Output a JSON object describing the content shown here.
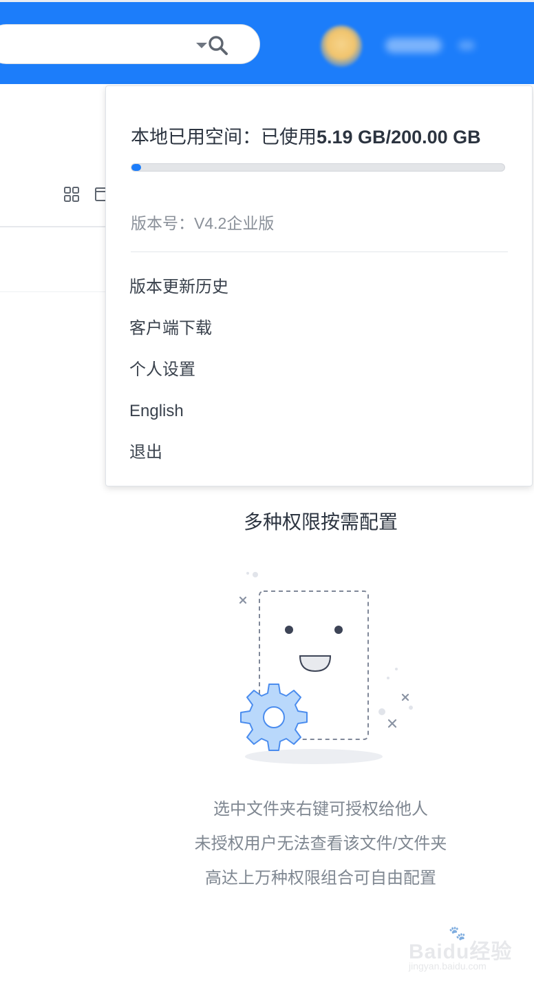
{
  "header": {
    "search": {
      "value": "",
      "placeholder": ""
    },
    "user": {
      "avatar": "blurred-avatar",
      "name": ""
    }
  },
  "colors": {
    "brand_blue": "#1c7dfa",
    "text_dark": "#2c3440",
    "text_muted": "#8a9099",
    "accent_gear": "#b9d8fb"
  },
  "toolbar": {
    "icons": [
      "grid-view-icon",
      "list-view-icon"
    ]
  },
  "dropdown": {
    "storage": {
      "label": "本地已用空间：已使用",
      "used": "5.19 GB",
      "total": "/200.00 GB",
      "used_fraction": 0.026
    },
    "version": "版本号：V4.2企业版",
    "menu": [
      {
        "label": "版本更新历史"
      },
      {
        "label": "客户端下载"
      },
      {
        "label": "个人设置"
      },
      {
        "label": "English"
      },
      {
        "label": "退出"
      }
    ]
  },
  "empty_state": {
    "title": "多种权限按需配置",
    "lines": [
      "选中文件夹右键可授权给他人",
      "未授权用户无法查看该文件/文件夹",
      "高达上万种权限组合可自由配置"
    ]
  },
  "watermark": {
    "brand": "Baidu经验",
    "url": "jingyan.baidu.com"
  }
}
